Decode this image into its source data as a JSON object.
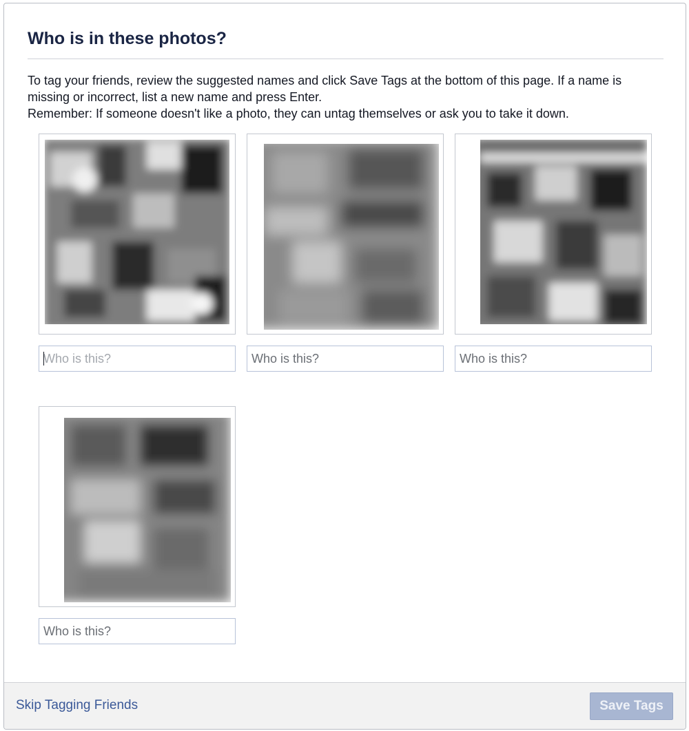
{
  "dialog": {
    "title": "Who is in these photos?",
    "instructions_line1": "To tag your friends, review the suggested names and click Save Tags at the bottom of this page. If a name is missing or incorrect, list a new name and press Enter.",
    "instructions_line2": "Remember: If someone doesn't like a photo, they can untag themselves or ask you to take it down."
  },
  "photos": [
    {
      "placeholder": "Who is this?",
      "focused": true
    },
    {
      "placeholder": "Who is this?",
      "focused": false
    },
    {
      "placeholder": "Who is this?",
      "focused": false
    },
    {
      "placeholder": "Who is this?",
      "focused": false
    }
  ],
  "footer": {
    "skip_label": "Skip Tagging Friends",
    "save_label": "Save Tags",
    "save_disabled": true
  }
}
